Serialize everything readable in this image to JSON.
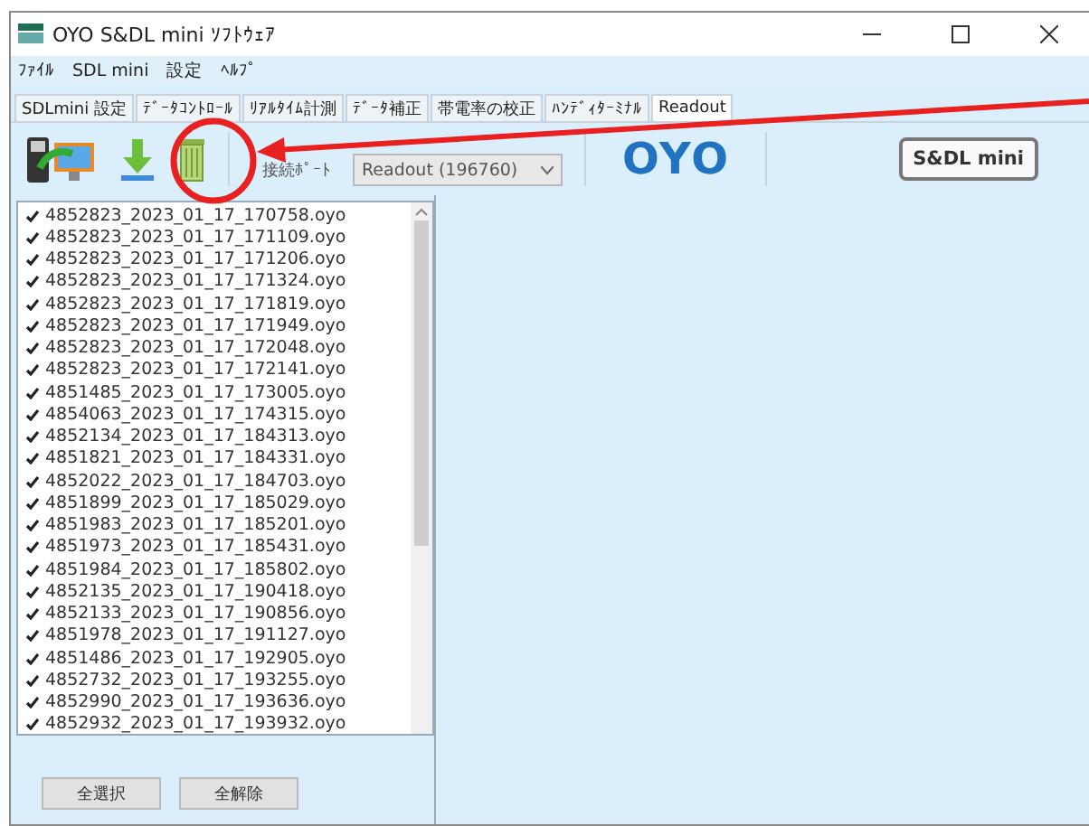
{
  "window": {
    "title": "OYO S&DL mini ｿﾌﾄｳｪｱ"
  },
  "menu": [
    "ﾌｧｲﾙ",
    "SDL mini",
    "設定",
    "ﾍﾙﾌﾟ"
  ],
  "tabs": [
    {
      "label": "SDLmini 設定",
      "selected": false
    },
    {
      "label": "ﾃﾞｰﾀｺﾝﾄﾛｰﾙ",
      "selected": false
    },
    {
      "label": "ﾘｱﾙﾀｲﾑ計測",
      "selected": false
    },
    {
      "label": "ﾃﾞｰﾀ補正",
      "selected": false
    },
    {
      "label": "帯電率の校正",
      "selected": false
    },
    {
      "label": "ﾊﾝﾃﾞｨﾀｰﾐﾅﾙ",
      "selected": false
    },
    {
      "label": "Readout",
      "selected": true
    }
  ],
  "toolbar": {
    "port_label": "接続ﾎﾟｰﾄ",
    "port_value": "Readout (196760)",
    "logo": "OYO",
    "badge": "S&DL mini"
  },
  "files": [
    {
      "name": "4852823_2023_01_17_170758.oyo",
      "checked": true
    },
    {
      "name": "4852823_2023_01_17_171109.oyo",
      "checked": true
    },
    {
      "name": "4852823_2023_01_17_171206.oyo",
      "checked": true
    },
    {
      "name": "4852823_2023_01_17_171324.oyo",
      "checked": true
    },
    {
      "name": "4852823_2023_01_17_171819.oyo",
      "checked": true
    },
    {
      "name": "4852823_2023_01_17_171949.oyo",
      "checked": true
    },
    {
      "name": "4852823_2023_01_17_172048.oyo",
      "checked": true
    },
    {
      "name": "4852823_2023_01_17_172141.oyo",
      "checked": true
    },
    {
      "name": "4851485_2023_01_17_173005.oyo",
      "checked": true
    },
    {
      "name": "4854063_2023_01_17_174315.oyo",
      "checked": true
    },
    {
      "name": "4852134_2023_01_17_184313.oyo",
      "checked": true
    },
    {
      "name": "4851821_2023_01_17_184331.oyo",
      "checked": true
    },
    {
      "name": "4852022_2023_01_17_184703.oyo",
      "checked": true
    },
    {
      "name": "4851899_2023_01_17_185029.oyo",
      "checked": true
    },
    {
      "name": "4851983_2023_01_17_185201.oyo",
      "checked": true
    },
    {
      "name": "4851973_2023_01_17_185431.oyo",
      "checked": true
    },
    {
      "name": "4851984_2023_01_17_185802.oyo",
      "checked": true
    },
    {
      "name": "4852135_2023_01_17_190418.oyo",
      "checked": true
    },
    {
      "name": "4852133_2023_01_17_190856.oyo",
      "checked": true
    },
    {
      "name": "4851978_2023_01_17_191127.oyo",
      "checked": true
    },
    {
      "name": "4851486_2023_01_17_192905.oyo",
      "checked": true
    },
    {
      "name": "4852732_2023_01_17_193255.oyo",
      "checked": true
    },
    {
      "name": "4852990_2023_01_17_193636.oyo",
      "checked": true
    },
    {
      "name": "4852932_2023_01_17_193932.oyo",
      "checked": true
    }
  ],
  "buttons": [
    "全選択",
    "全解除"
  ]
}
